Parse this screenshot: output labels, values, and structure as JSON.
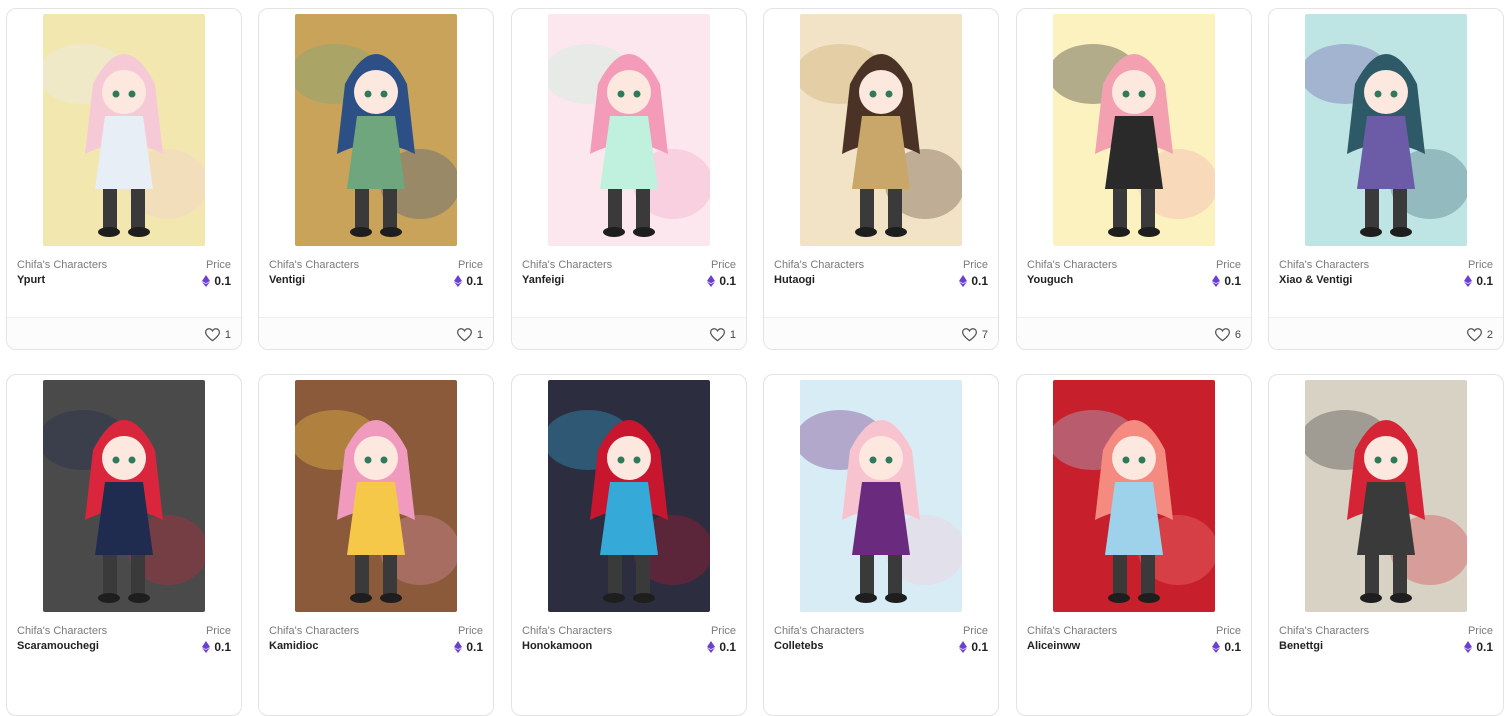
{
  "colors": {
    "eth": "#6b3fd4",
    "text_muted": "#7a7a7a",
    "text_main": "#222222",
    "border": "#e3e3e3"
  },
  "icons": {
    "price": "ethereum-icon",
    "like": "heart-outline-icon"
  },
  "cards": [
    {
      "collection": "Chifa's Characters",
      "name": "Ypurt",
      "price_label": "Price",
      "price": "0.1",
      "likes": "1",
      "palette": [
        "#f6c9d7",
        "#e8eef6",
        "#f3e7b0"
      ]
    },
    {
      "collection": "Chifa's Characters",
      "name": "Ventigi",
      "price_label": "Price",
      "price": "0.1",
      "likes": "1",
      "palette": [
        "#2c4f86",
        "#6fa67e",
        "#c9a35a"
      ]
    },
    {
      "collection": "Chifa's Characters",
      "name": "Yanfeigi",
      "price_label": "Price",
      "price": "0.1",
      "likes": "1",
      "palette": [
        "#f39bb8",
        "#bff1de",
        "#fde7ef"
      ]
    },
    {
      "collection": "Chifa's Characters",
      "name": "Hutaogi",
      "price_label": "Price",
      "price": "0.1",
      "likes": "7",
      "palette": [
        "#4a3226",
        "#c9a76a",
        "#f2e3c6"
      ]
    },
    {
      "collection": "Chifa's Characters",
      "name": "Youguch",
      "price_label": "Price",
      "price": "0.1",
      "likes": "6",
      "palette": [
        "#f3a1b1",
        "#2a2a2a",
        "#fbf2bf"
      ]
    },
    {
      "collection": "Chifa's Characters",
      "name": "Xiao & Ventigi",
      "price_label": "Price",
      "price": "0.1",
      "likes": "2",
      "palette": [
        "#2d5a66",
        "#6c5ca8",
        "#bfe4e4"
      ]
    },
    {
      "collection": "Chifa's Characters",
      "name": "Scaramouchegi",
      "price_label": "Price",
      "price": "0.1",
      "likes": "",
      "palette": [
        "#d9263d",
        "#1f2b4f",
        "#4a4a4a"
      ]
    },
    {
      "collection": "Chifa's Characters",
      "name": "Kamidioc",
      "price_label": "Price",
      "price": "0.1",
      "likes": "",
      "palette": [
        "#f09abd",
        "#f5c84a",
        "#8a5a3a"
      ]
    },
    {
      "collection": "Chifa's Characters",
      "name": "Honokamoon",
      "price_label": "Price",
      "price": "0.1",
      "likes": "",
      "palette": [
        "#c8162f",
        "#35a9d8",
        "#2d2d40"
      ]
    },
    {
      "collection": "Chifa's Characters",
      "name": "Colletebs",
      "price_label": "Price",
      "price": "0.1",
      "likes": "",
      "palette": [
        "#f7c3cf",
        "#6a2a7e",
        "#d8ecf6"
      ]
    },
    {
      "collection": "Chifa's Characters",
      "name": "Aliceinww",
      "price_label": "Price",
      "price": "0.1",
      "likes": "",
      "palette": [
        "#f58a80",
        "#9ed2ea",
        "#c81f2c"
      ]
    },
    {
      "collection": "Chifa's Characters",
      "name": "Benettgi",
      "price_label": "Price",
      "price": "0.1",
      "likes": "",
      "palette": [
        "#d42436",
        "#3a3a3a",
        "#d8d2c4"
      ]
    }
  ]
}
